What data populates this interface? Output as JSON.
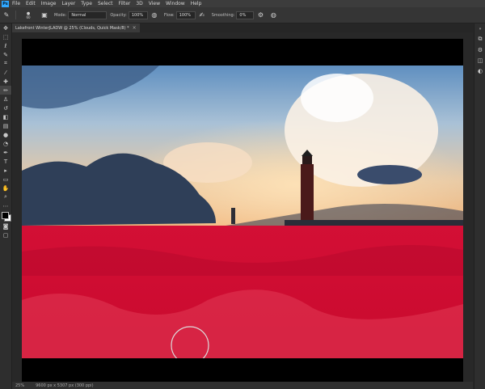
{
  "app": {
    "logo": "Ps"
  },
  "menu": [
    "File",
    "Edit",
    "Image",
    "Layer",
    "Type",
    "Select",
    "Filter",
    "3D",
    "View",
    "Window",
    "Help"
  ],
  "options": {
    "brush_size": "60",
    "mode_label": "Mode:",
    "mode_value": "Normal",
    "opacity_label": "Opacity:",
    "opacity_value": "100%",
    "flow_label": "Flow:",
    "flow_value": "100%",
    "smoothing_label": "Smoothing:",
    "smoothing_value": "0%"
  },
  "document": {
    "tab_title": "Lakefront WinterJLADW @ 25% (Clouds, Quick Mask/8) *",
    "close_glyph": "×"
  },
  "status": {
    "text": "25%",
    "doc_size": "9600 px x 5307 px (300 ppi)"
  },
  "tools": [
    "move-icon",
    "marquee-icon",
    "lasso-icon",
    "quick-select-icon",
    "crop-icon",
    "eyedropper-icon",
    "healing-icon",
    "brush-icon",
    "stamp-icon",
    "history-brush-icon",
    "eraser-icon",
    "gradient-icon",
    "blur-icon",
    "dodge-icon",
    "pen-icon",
    "type-icon",
    "path-select-icon",
    "shape-icon",
    "hand-icon",
    "zoom-icon",
    "more-icon"
  ],
  "colors": {
    "accent": "#31a8ff",
    "quick_mask": "#e0123c"
  }
}
